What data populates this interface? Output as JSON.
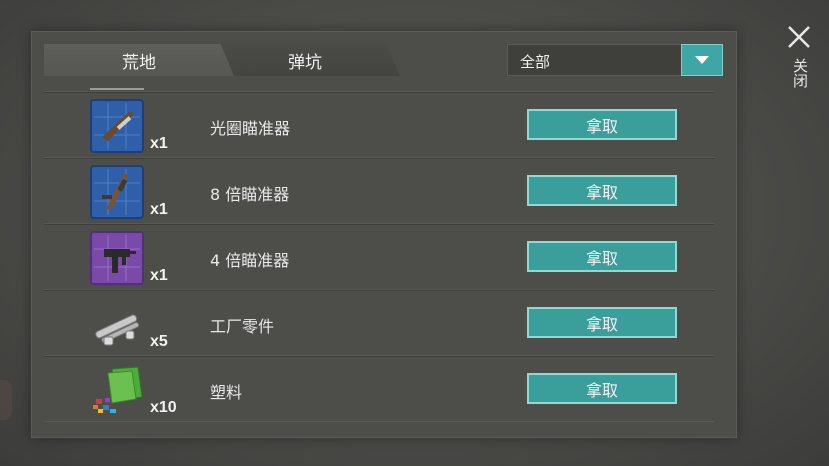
{
  "tabs": [
    {
      "label": "荒地",
      "active": true
    },
    {
      "label": "弹坑",
      "active": false
    }
  ],
  "filter": {
    "selected": "全部"
  },
  "close": {
    "label": "关闭"
  },
  "items": [
    {
      "name": "光圈瞄准器",
      "qty": "x1",
      "icon": "blueprint-shotgun-icon",
      "action": "拿取"
    },
    {
      "name": "8 倍瞄准器",
      "qty": "x1",
      "icon": "blueprint-rifle-icon",
      "action": "拿取"
    },
    {
      "name": "4 倍瞄准器",
      "qty": "x1",
      "icon": "blueprint-smg-purple-icon",
      "action": "拿取"
    },
    {
      "name": "工厂零件",
      "qty": "x5",
      "icon": "factory-parts-icon",
      "action": "拿取"
    },
    {
      "name": "塑料",
      "qty": "x10",
      "icon": "plastic-icon",
      "action": "拿取"
    }
  ],
  "colors": {
    "accent": "#3ea6a4",
    "blueprint_blue": "#2f5fa8",
    "blueprint_purple": "#7a4aa8"
  }
}
